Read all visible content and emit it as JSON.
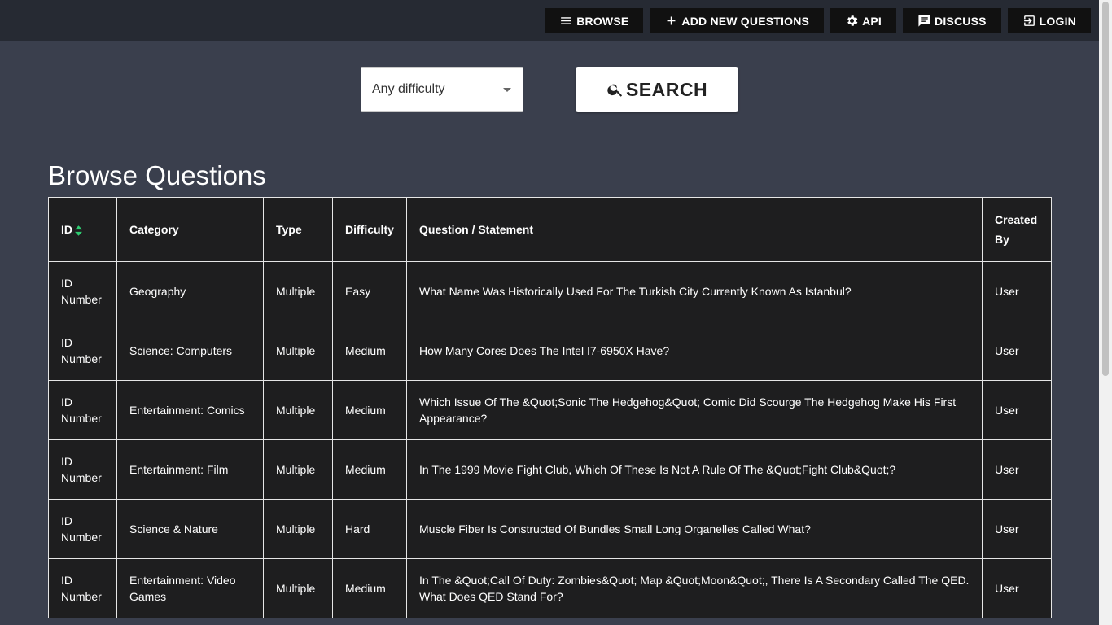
{
  "nav": {
    "items": [
      {
        "label": "BROWSE",
        "icon": "menu-icon"
      },
      {
        "label": "ADD NEW QUESTIONS",
        "icon": "plus-icon"
      },
      {
        "label": "API",
        "icon": "gear-icon"
      },
      {
        "label": "DISCUSS",
        "icon": "chat-icon"
      },
      {
        "label": "LOGIN",
        "icon": "login-icon"
      }
    ]
  },
  "filters": {
    "difficulty": {
      "selected": "Any difficulty"
    },
    "search_label": "SEARCH"
  },
  "page_title": "Browse Questions",
  "table": {
    "headers": [
      "ID",
      "Category",
      "Type",
      "Difficulty",
      "Question / Statement",
      "Created By"
    ],
    "rows": [
      {
        "id": "ID Number",
        "category": "Geography",
        "type": "Multiple",
        "difficulty": "Easy",
        "question": "What Name Was Historically Used For The Turkish City Currently Known As Istanbul?",
        "created_by": "User"
      },
      {
        "id": "ID Number",
        "category": "Science: Computers",
        "type": "Multiple",
        "difficulty": "Medium",
        "question": "How Many Cores Does The Intel I7-6950X Have?",
        "created_by": "User"
      },
      {
        "id": "ID Number",
        "category": "Entertainment: Comics",
        "type": "Multiple",
        "difficulty": "Medium",
        "question": "Which Issue Of The &Quot;Sonic The Hedgehog&Quot; Comic Did Scourge The Hedgehog Make His First Appearance?",
        "created_by": "User"
      },
      {
        "id": "ID Number",
        "category": "Entertainment: Film",
        "type": "Multiple",
        "difficulty": "Medium",
        "question": "In The 1999 Movie Fight Club, Which Of These Is Not A Rule Of The &Quot;Fight Club&Quot;?",
        "created_by": "User"
      },
      {
        "id": "ID Number",
        "category": "Science & Nature",
        "type": "Multiple",
        "difficulty": "Hard",
        "question": "Muscle Fiber Is Constructed Of Bundles Small Long Organelles Called What?",
        "created_by": "User"
      },
      {
        "id": "ID Number",
        "category": "Entertainment: Video Games",
        "type": "Multiple",
        "difficulty": "Medium",
        "question": "In The &Quot;Call Of Duty: Zombies&Quot; Map &Quot;Moon&Quot;, There Is A Secondary Called The QED. What Does QED Stand For?",
        "created_by": "User"
      }
    ]
  },
  "colors": {
    "background": "#3a3f4d",
    "topbar": "#262a33",
    "table_bg": "#1e1e1f",
    "sort_accent": "#2ecc71"
  }
}
